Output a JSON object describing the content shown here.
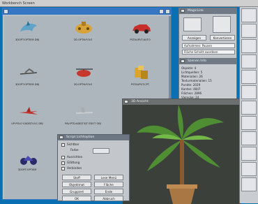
{
  "screen": {
    "title": "Workbench Screen"
  },
  "workbench": {
    "icons": [
      {
        "label": "3DOPT:OPTIEM DBJ",
        "name": "dolphin-object-icon"
      },
      {
        "label": "2D-OPTN:FOLE",
        "name": "submarine-object-icon"
      },
      {
        "label": "PSTAUPUT:AUTO",
        "name": "red-car-object-icon"
      },
      {
        "label": "3DOPT:OPTIEM DBJ",
        "name": "skier-object-icon"
      },
      {
        "label": "2D:OPTN:FOLE",
        "name": "helicopter-object-icon"
      },
      {
        "label": "PSTAUPUT:CPT",
        "name": "gold-blocks-object-icon"
      },
      {
        "label": "UP:POLO EADEJT:ULC DBJ",
        "name": "red-plane-object-icon"
      },
      {
        "label": "PAV:PTD:ADEJT:EJT EDOT OBJ",
        "name": "small-plane-object-icon"
      },
      {
        "label": "3DOPT:OPTIEM",
        "name": "motorbike-object-icon"
      }
    ]
  },
  "magiclink": {
    "title": "MagicLink",
    "buttons": [
      "Anzeigen",
      "Konvertieren"
    ],
    "fields": [
      "Aufnahmen: Pausen",
      "Fläche Schnitt zuordnen"
    ]
  },
  "szenen_info": {
    "title": "Szenen Info",
    "lines": [
      "Objekte: 4",
      "Lichtquellen: 5",
      "Materialien: 26",
      "Texturmaterialien: 15",
      "Punkte: 2029",
      "Kanten: 4847",
      "Flächen: 2896",
      "Vierecke: 24",
      "Größe: 90886 Bytes"
    ]
  },
  "view3d": {
    "title": "3D Ansicht"
  },
  "script": {
    "title": "Script Lichtoption",
    "options": [
      "Sichtbar",
      "Ausrichten",
      "Glättung",
      "Verbinden"
    ],
    "extra_label": "Farbe",
    "buttons": [
      "Stoff",
      "Lese Menü",
      "Objektmat",
      "Fläche",
      "Gruppiert",
      "Ende",
      "OK",
      "Abbruch"
    ]
  },
  "colors": {
    "desktop": "#0a6fb3",
    "title_bar": "#3677c4",
    "window_bg": "#b8bfc6"
  }
}
